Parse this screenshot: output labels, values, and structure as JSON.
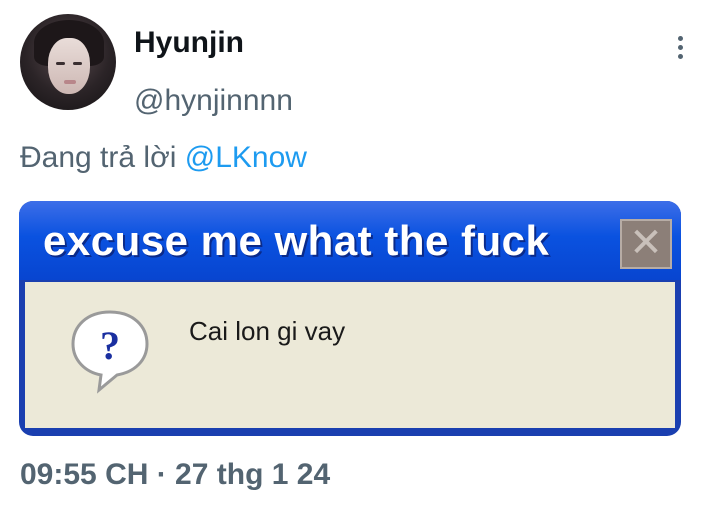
{
  "tweet": {
    "display_name": "Hyunjin",
    "handle": "@hynjinnnn",
    "reply_prefix": "Đang trả lời ",
    "reply_mention": "@LKnow",
    "timestamp": "09:55 CH · 27 thg 1 24"
  },
  "media": {
    "dialog_title": "excuse me what the fuck",
    "dialog_message": "Cai lon gi vay",
    "close_glyph": "✕",
    "question_glyph": "?"
  },
  "colors": {
    "mention": "#1d9bf0",
    "secondary_text": "#536471",
    "title_bar": "#0a52e0"
  }
}
